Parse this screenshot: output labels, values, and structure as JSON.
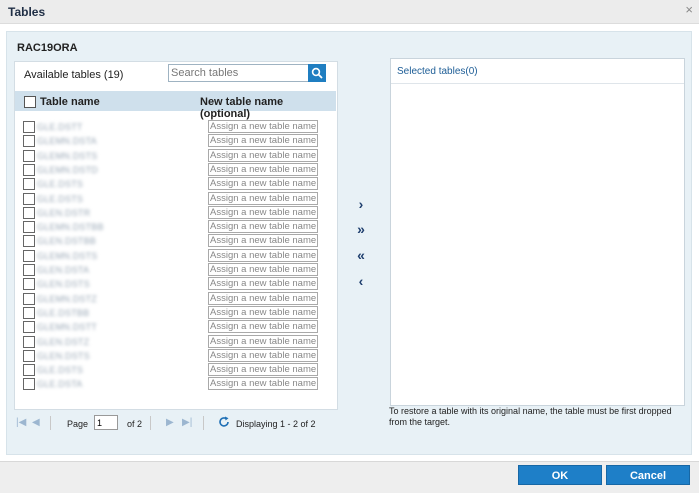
{
  "window": {
    "title": "Tables",
    "close_glyph": "×"
  },
  "source": {
    "name": "RAC19ORA"
  },
  "available": {
    "label": "Available tables (19)"
  },
  "search": {
    "placeholder": "Search tables",
    "value": ""
  },
  "columns": {
    "table_name": "Table name",
    "new_table_name": "New table name (optional)"
  },
  "rows": [
    {
      "name": "GLE.DSTT",
      "new_placeholder": "Assign a new table name"
    },
    {
      "name": "GLEMN.DSTA",
      "new_placeholder": "Assign a new table name"
    },
    {
      "name": "GLEMN.DSTS",
      "new_placeholder": "Assign a new table name"
    },
    {
      "name": "GLEMN.DSTD",
      "new_placeholder": "Assign a new table name"
    },
    {
      "name": "GLE.DSTS",
      "new_placeholder": "Assign a new table name"
    },
    {
      "name": "GLE.DSTS",
      "new_placeholder": "Assign a new table name"
    },
    {
      "name": "GLEN.DSTR",
      "new_placeholder": "Assign a new table name"
    },
    {
      "name": "GLEMN.DSTBB",
      "new_placeholder": "Assign a new table name"
    },
    {
      "name": "GLEN.DSTBB",
      "new_placeholder": "Assign a new table name"
    },
    {
      "name": "GLEMN.DSTS",
      "new_placeholder": "Assign a new table name"
    },
    {
      "name": "GLEN.DSTA",
      "new_placeholder": "Assign a new table name"
    },
    {
      "name": "GLEN.DSTS",
      "new_placeholder": "Assign a new table name"
    },
    {
      "name": "GLEMN.DSTZ",
      "new_placeholder": "Assign a new table name"
    },
    {
      "name": "GLE.DSTBB",
      "new_placeholder": "Assign a new table name"
    },
    {
      "name": "GLEMN.DSTT",
      "new_placeholder": "Assign a new table name"
    },
    {
      "name": "GLEN.DSTZ",
      "new_placeholder": "Assign a new table name"
    },
    {
      "name": "GLEN.DSTS",
      "new_placeholder": "Assign a new table name"
    },
    {
      "name": "GLE.DSTS",
      "new_placeholder": "Assign a new table name"
    },
    {
      "name": "GLE.DSTA",
      "new_placeholder": "Assign a new table name"
    }
  ],
  "pager": {
    "page_label": "Page",
    "page_value": "1",
    "of_label": "of 2",
    "displaying": "Displaying 1 - 2 of 2"
  },
  "transfer": {
    "add": "›",
    "add_all": "»",
    "remove_all": "«",
    "remove": "‹"
  },
  "selected": {
    "label": "Selected tables(0)"
  },
  "note": "To restore a table with its original name, the table must be first dropped from the target.",
  "footer": {
    "ok": "OK",
    "cancel": "Cancel"
  },
  "colors": {
    "accent": "#1e7fc8",
    "header_bg": "#cfe0ec",
    "panel_bg": "#e8f1f6"
  }
}
